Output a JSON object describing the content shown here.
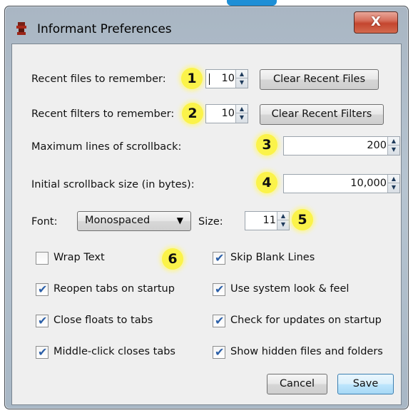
{
  "window": {
    "title": "Informant Preferences",
    "close_label": "X",
    "accent_color": "#c4462f"
  },
  "rows": {
    "recent_files": {
      "label": "Recent files to remember:",
      "badge": "1",
      "value": "10",
      "button": "Clear Recent Files"
    },
    "recent_filters": {
      "label": "Recent filters to remember:",
      "badge": "2",
      "value": "10",
      "button": "Clear Recent Filters"
    },
    "max_scrollback": {
      "label": "Maximum lines of scrollback:",
      "badge": "3",
      "value": "200"
    },
    "initial_scrollback": {
      "label": "Initial scrollback size (in bytes):",
      "badge": "4",
      "value": "10,000"
    }
  },
  "font": {
    "label": "Font:",
    "selected": "Monospaced",
    "size_label": "Size:",
    "size_value": "11",
    "badge": "5"
  },
  "options_badge": "6",
  "checkboxes": [
    {
      "label": "Wrap Text",
      "checked": false
    },
    {
      "label": "Skip Blank Lines",
      "checked": true
    },
    {
      "label": "Reopen tabs on startup",
      "checked": true
    },
    {
      "label": "Use system look & feel",
      "checked": true
    },
    {
      "label": "Close floats to tabs",
      "checked": true
    },
    {
      "label": "Check for updates on startup",
      "checked": true
    },
    {
      "label": "Middle-click closes tabs",
      "checked": true
    },
    {
      "label": "Show hidden files and folders",
      "checked": true
    }
  ],
  "buttons": {
    "cancel": "Cancel",
    "save": "Save"
  },
  "check_mark": "✔"
}
